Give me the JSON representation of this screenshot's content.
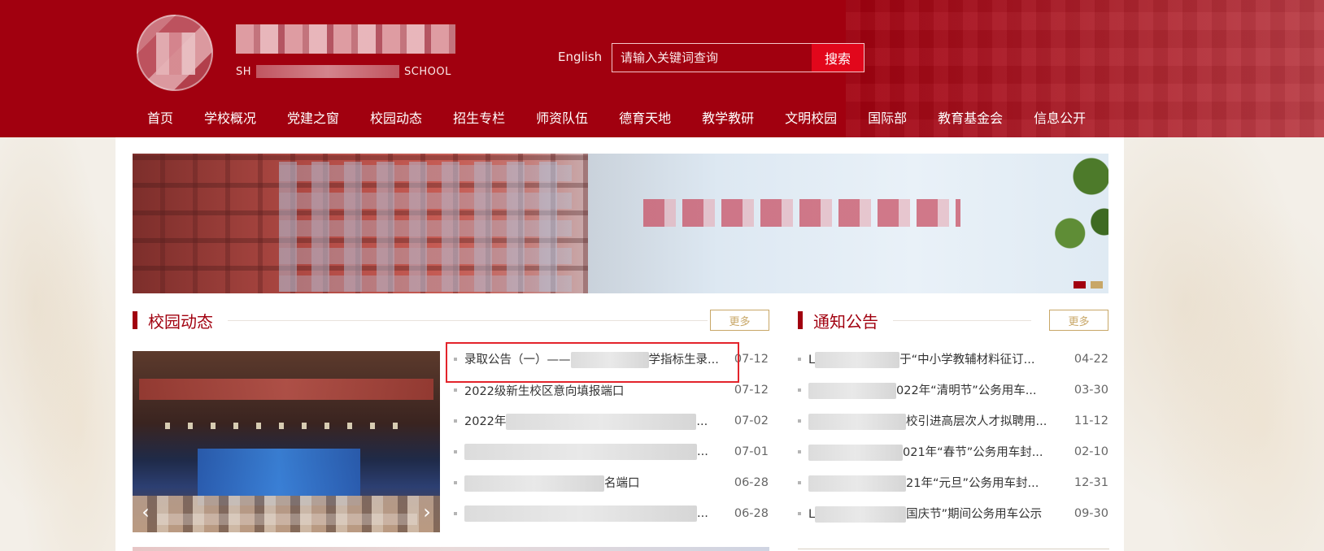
{
  "header": {
    "school_en_left": "SH",
    "school_en_right": "SCHOOL",
    "lang_link": "English",
    "search": {
      "placeholder": "请输入关键词查询",
      "button": "搜索"
    }
  },
  "nav": [
    {
      "label": "首页"
    },
    {
      "label": "学校概况"
    },
    {
      "label": "党建之窗"
    },
    {
      "label": "校园动态"
    },
    {
      "label": "招生专栏"
    },
    {
      "label": "师资队伍"
    },
    {
      "label": "德育天地"
    },
    {
      "label": "教学教研"
    },
    {
      "label": "文明校园"
    },
    {
      "label": "国际部"
    },
    {
      "label": "教育基金会"
    },
    {
      "label": "信息公开"
    }
  ],
  "campus_news": {
    "title": "校园动态",
    "more": "更多",
    "items": [
      {
        "prefix": "录取公告（一）——",
        "suffix": "学指标生录...",
        "date": "07-12"
      },
      {
        "prefix": "2022级新生校区意向填报端口",
        "suffix": "",
        "date": "07-12"
      },
      {
        "prefix": "2022年",
        "suffix": "...",
        "date": "07-02"
      },
      {
        "prefix": "",
        "suffix": "...",
        "date": "07-01"
      },
      {
        "prefix": "",
        "suffix": "名端口",
        "date": "06-28"
      },
      {
        "prefix": "",
        "suffix": "...",
        "date": "06-28"
      }
    ]
  },
  "notices": {
    "title": "通知公告",
    "more": "更多",
    "items": [
      {
        "prefix": "L",
        "suffix": "于“中小学教辅材料征订...",
        "date": "04-22"
      },
      {
        "prefix": "",
        "suffix": "022年“清明节”公务用车...",
        "date": "03-30"
      },
      {
        "prefix": "",
        "suffix": "校引进高层次人才拟聘用...",
        "date": "11-12"
      },
      {
        "prefix": "",
        "suffix": "021年“春节”公务用车封...",
        "date": "02-10"
      },
      {
        "prefix": "",
        "suffix": "21年“元旦”公务用车封...",
        "date": "12-31"
      },
      {
        "prefix": "L",
        "suffix": "国庆节”期间公务用车公示",
        "date": "09-30"
      }
    ]
  },
  "carousel": {
    "left_arrow": "‹",
    "right_arrow": "›"
  }
}
